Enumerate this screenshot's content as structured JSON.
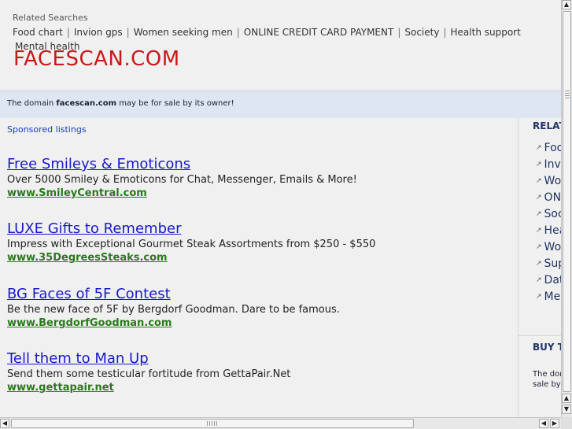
{
  "header": {
    "related_label": "Related Searches",
    "related_links": [
      "Food chart",
      "Invion gps",
      "Women seeking men",
      "ONLINE CREDIT CARD PAYMENT",
      "Society",
      "Health support",
      "Mental health"
    ],
    "separator": "|",
    "site_title": "FACESCAN.COM"
  },
  "sale_notice": {
    "prefix": "The domain",
    "domain": "facescan.com",
    "suffix": "may be for sale by its owner!"
  },
  "main": {
    "sponsored_label": "Sponsored listings",
    "ads": [
      {
        "title": "Free Smileys & Emoticons",
        "description": "Over 5000 Smiley & Emoticons for Chat, Messenger, Emails & More!",
        "url": "www.SmileyCentral.com"
      },
      {
        "title": "LUXE Gifts to Remember",
        "description": "Impress with Exceptional Gourmet Steak Assortments from $250 - $550",
        "url": "www.35DegreesSteaks.com"
      },
      {
        "title": "BG Faces of 5F Contest",
        "description": "Be the new face of 5F by Bergdorf Goodman. Dare to be famous.",
        "url": "www.BergdorfGoodman.com"
      },
      {
        "title": "Tell them to Man Up",
        "description": "Send them some testicular fortitude from GettaPair.Net",
        "url": "www.gettapair.net"
      }
    ]
  },
  "sidebar": {
    "heading": "RELATED SEARCHES",
    "items": [
      "Food chart",
      "Invion gps",
      "Women seeking men",
      "ONLINE CREDIT CARD PAYMENT",
      "Society",
      "Health support",
      "Women seeking men",
      "Support groups",
      "Dating",
      "Mental health"
    ],
    "bullet_icon": "arrow-bullet-icon",
    "buy_heading": "BUY THIS DOMAIN",
    "buy_text": "The domain facescan.com may be for sale by its owner!"
  },
  "colors": {
    "title_red": "#c8191a",
    "ad_title_blue": "#1a1acc",
    "ad_url_green": "#2a7a1c",
    "sale_bar_bg": "#dde6f2"
  }
}
